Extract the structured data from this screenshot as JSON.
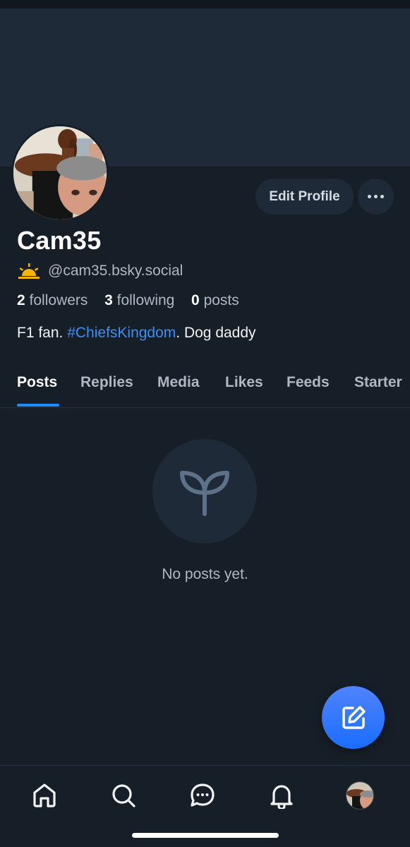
{
  "profile": {
    "display_name": "Cam35",
    "handle": "@cam35.bsky.social",
    "stats": {
      "followers_count": "2",
      "followers_label": "followers",
      "following_count": "3",
      "following_label": "following",
      "posts_count": "0",
      "posts_label": "posts"
    },
    "bio": {
      "prefix": "F1 fan. ",
      "hashtag": "#ChiefsKingdom",
      "suffix": ". Dog daddy"
    }
  },
  "actions": {
    "edit_label": "Edit Profile",
    "more_icon": "ellipsis-icon"
  },
  "tabs": [
    {
      "label": "Posts",
      "active": true
    },
    {
      "label": "Replies",
      "active": false
    },
    {
      "label": "Media",
      "active": false
    },
    {
      "label": "Likes",
      "active": false
    },
    {
      "label": "Feeds",
      "active": false
    },
    {
      "label": "Starter",
      "active": false
    }
  ],
  "empty_state": {
    "icon": "seedling-icon",
    "text": "No posts yet."
  },
  "fab": {
    "icon": "compose-icon"
  },
  "nav": [
    {
      "icon": "home-icon"
    },
    {
      "icon": "search-icon"
    },
    {
      "icon": "chat-icon"
    },
    {
      "icon": "bell-icon"
    },
    {
      "icon": "profile-avatar"
    }
  ],
  "colors": {
    "background": "#161e27",
    "banner": "#1e2a37",
    "accent": "#208bfe",
    "hashtag": "#3a8ef6",
    "muted_text": "#aeb8c4"
  }
}
